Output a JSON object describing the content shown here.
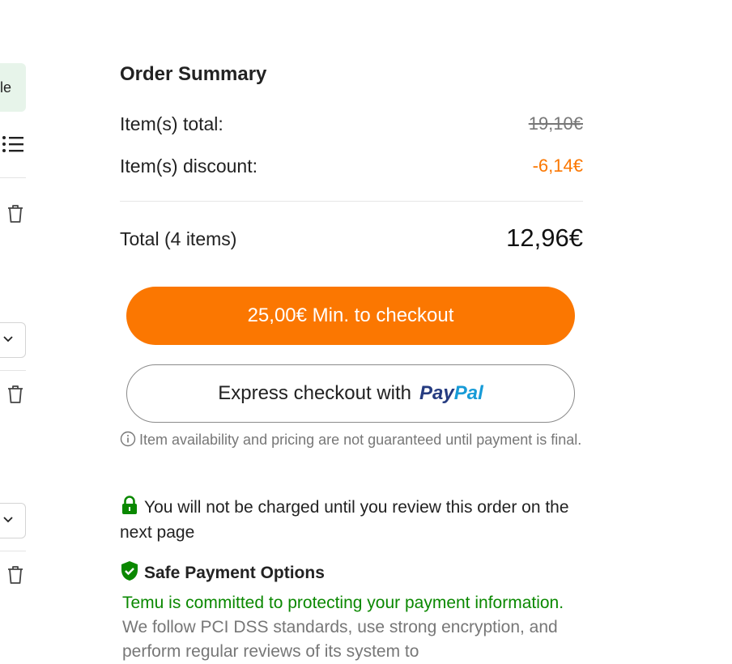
{
  "left_column": {
    "pill_text": "le"
  },
  "order_summary": {
    "title": "Order Summary",
    "items_total_label": "Item(s) total:",
    "items_total_value": "19,10€",
    "items_discount_label": "Item(s) discount:",
    "items_discount_value": "-6,14€",
    "total_label": "Total (4 items)",
    "total_value": "12,96€"
  },
  "buttons": {
    "checkout_label": "25,00€ Min. to checkout",
    "express_label": "Express checkout with",
    "paypal_pay": "Pay",
    "paypal_pal": "Pal"
  },
  "notice": {
    "availability": "Item availability and pricing are not guaranteed until payment is final."
  },
  "charge_notice": "You will not be charged until you review this order on the next page",
  "safe_payment": {
    "title": "Safe Payment Options",
    "highlight": "Temu is committed to protecting your payment information.",
    "body": " We follow PCI DSS standards, use strong encryption, and perform regular reviews of its system to"
  },
  "colors": {
    "accent_orange": "#fb7701",
    "success_green": "#0a8800",
    "paypal_dark": "#253b80",
    "paypal_light": "#179bd7"
  },
  "icons": [
    "list-icon",
    "trash-icon",
    "chevron-down-icon",
    "info-icon",
    "lock-icon",
    "shield-check-icon"
  ]
}
